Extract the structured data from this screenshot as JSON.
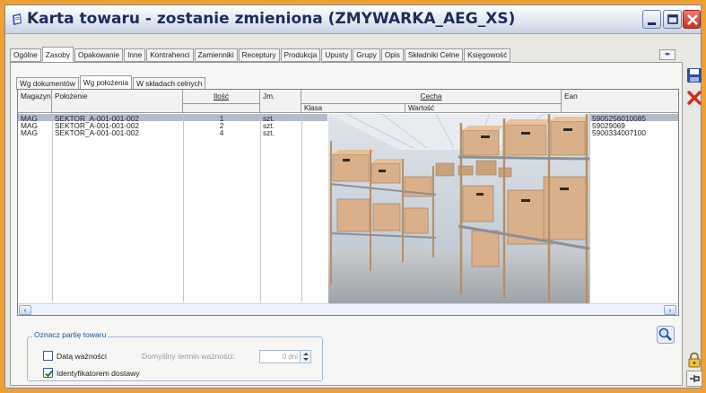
{
  "window": {
    "title": "Karta towaru - zostanie zmieniona (ZMYWARKA_AEG_XS)"
  },
  "main_tabs": [
    {
      "label": "Ogólne",
      "active": false
    },
    {
      "label": "Zasoby",
      "active": true
    },
    {
      "label": "Opakowanie",
      "active": false
    },
    {
      "label": "Inne",
      "active": false
    },
    {
      "label": "Kontrahenci",
      "active": false
    },
    {
      "label": "Zamienniki",
      "active": false
    },
    {
      "label": "Receptury",
      "active": false
    },
    {
      "label": "Produkcja",
      "active": false
    },
    {
      "label": "Upusty",
      "active": false
    },
    {
      "label": "Grupy",
      "active": false
    },
    {
      "label": "Opis",
      "active": false
    },
    {
      "label": "Składniki Celne",
      "active": false
    },
    {
      "label": "Księgowość",
      "active": false
    }
  ],
  "sub_tabs": [
    {
      "label": "Wg dokumentów",
      "active": false
    },
    {
      "label": "Wg położenia",
      "active": true
    },
    {
      "label": "W składach celnych",
      "active": false
    }
  ],
  "grid": {
    "headers": {
      "magazyn": "Magazyn",
      "polozenie": "Położenie",
      "ilosc": "Ilość",
      "jm": "Jm.",
      "cecha": "Cecha",
      "klasa": "Klasa",
      "wartosc": "Wartość",
      "ean": "Ean"
    },
    "rows": [
      {
        "magazyn": "MAG",
        "polozenie": "SEKTOR_A-001-001-002",
        "ilosc": "1",
        "jm": "szt.",
        "ean": "5905256010085",
        "selected": true
      },
      {
        "magazyn": "MAG",
        "polozenie": "SEKTOR_A-001-001-002",
        "ilosc": "2",
        "jm": "szt.",
        "ean": "59029069",
        "selected": false
      },
      {
        "magazyn": "MAG",
        "polozenie": "SEKTOR_A-001-001-002",
        "ilosc": "4",
        "jm": "szt.",
        "ean": "5900334007100",
        "selected": false
      }
    ]
  },
  "batch_group": {
    "title": "Oznacz partię towaru",
    "expiry_label": "Datą ważności",
    "expiry_checked": false,
    "default_term_label": "Domyślny termin ważności:",
    "default_term_value": "0 dni",
    "supplier_id_label": "Identyfikatorem dostawy",
    "supplier_id_checked": true
  },
  "icons": {
    "save": "save-icon",
    "cancel": "close-red-icon",
    "search": "magnifier-icon",
    "lock": "padlock-icon",
    "pin": "pin-icon"
  },
  "colors": {
    "outer_frame": "#f0a030",
    "title_text": "#1d2c5a",
    "selection": "#b3bccd",
    "group_title": "#1f4fa8"
  }
}
